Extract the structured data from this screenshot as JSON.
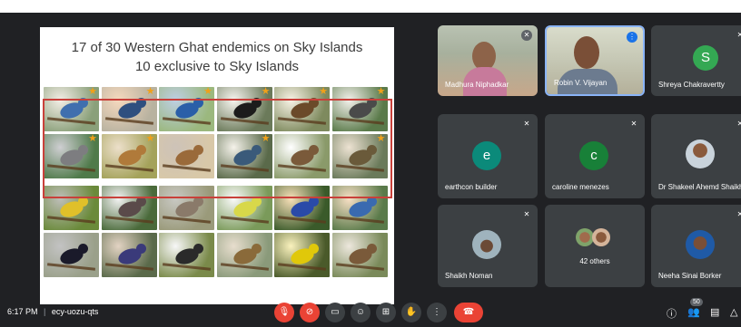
{
  "slide": {
    "title_line1": "17 of 30 Western Ghat endemics on Sky Islands",
    "title_line2": "10 exclusive to Sky Islands",
    "bird_rows": 4,
    "bird_cols": 6,
    "starred_count": 10
  },
  "participants": [
    {
      "name": "Madhura Niphadkar",
      "type": "video"
    },
    {
      "name": "Robin V. Vijayan",
      "type": "video",
      "speaking": true
    },
    {
      "name": "Shreya Chakravertty",
      "type": "avatar",
      "letter": "S",
      "color": "#34a853"
    },
    {
      "name": "earthcon builder",
      "type": "avatar",
      "letter": "e",
      "color": "#0b8a7a"
    },
    {
      "name": "caroline menezes",
      "type": "avatar",
      "letter": "c",
      "color": "#188038"
    },
    {
      "name": "Dr Shakeel Ahemd Shaikh",
      "type": "photo"
    },
    {
      "name": "Shaikh Noman",
      "type": "photo"
    },
    {
      "name": "42 others",
      "type": "group"
    },
    {
      "name": "Neeha Sinai Borker",
      "type": "photo"
    }
  ],
  "bottom_bar": {
    "time": "6:17 PM",
    "separator": "|",
    "meeting_code": "ecy-uozu-qts",
    "participant_count": "50",
    "colors": {
      "danger": "#ea4335",
      "button": "#3c4043",
      "bar": "#202124"
    }
  }
}
